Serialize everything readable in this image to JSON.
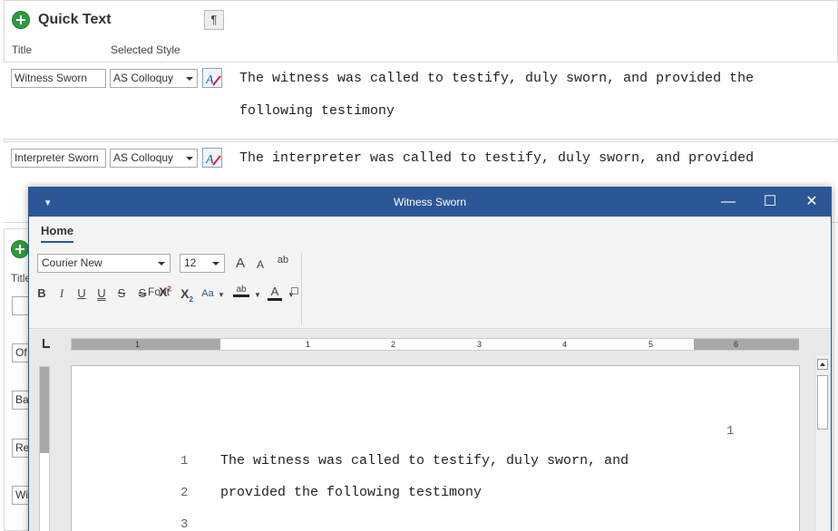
{
  "quick_text": {
    "title": "Quick Text",
    "col_title": "Title",
    "col_style": "Selected Style",
    "rows": [
      {
        "title": "Witness Sworn",
        "style": "AS Colloquy",
        "text_line1": "The witness was called to testify, duly sworn, and provided the",
        "text_line2": "following testimony"
      },
      {
        "title": "Interpreter Sworn",
        "style": "AS Colloquy",
        "text_line1": "The interpreter was called to testify, duly sworn, and provided",
        "text_line2": ""
      }
    ]
  },
  "panel2": {
    "title_label": "Title",
    "stubs": [
      "",
      "Of",
      "Ba",
      "Re",
      "Wi"
    ]
  },
  "dialog": {
    "title": "Witness Sworn",
    "menu_glyph": "▾",
    "minimize_glyph": "—",
    "maximize_glyph": "☐",
    "close_glyph": "✕",
    "tab": "Home",
    "font_name": "Courier New",
    "font_size": "12",
    "font_group_label": "Font",
    "icons": {
      "grow": "A",
      "shrink": "A",
      "clear": "ab",
      "bold": "B",
      "italic": "I",
      "underline": "U",
      "dunderline": "U",
      "strike": "S",
      "dstrike": "S",
      "superscript": "X",
      "subscript": "X",
      "case": "Aa",
      "highlight": "ab",
      "color": "A"
    },
    "ruler_numbers": [
      "1",
      "1",
      "2",
      "3",
      "4",
      "5",
      "6"
    ],
    "page_number": "1",
    "lines": [
      {
        "num": "1",
        "text": "The witness was called to testify, duly sworn, and"
      },
      {
        "num": "2",
        "text": "provided the following testimony"
      },
      {
        "num": "3",
        "text": ""
      }
    ]
  }
}
